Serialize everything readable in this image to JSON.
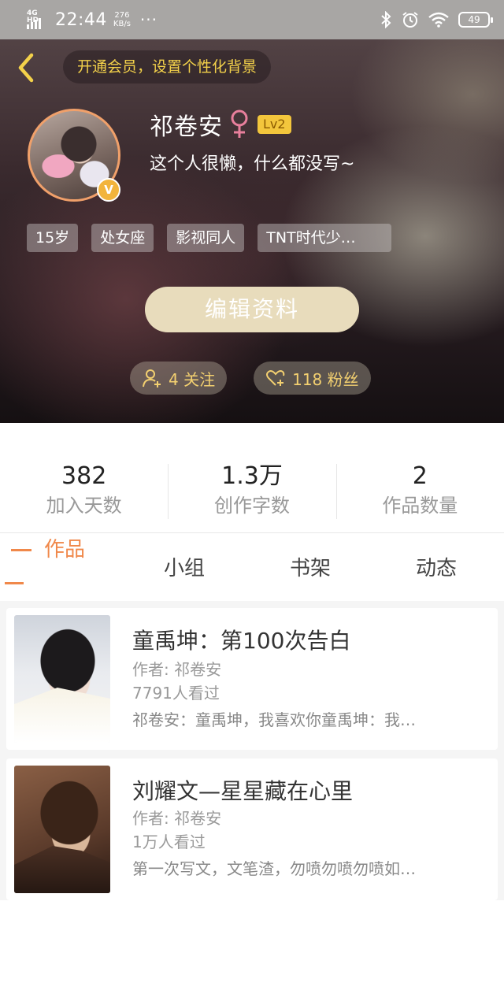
{
  "status_bar": {
    "network": "4G HD",
    "time": "22:44",
    "speed_value": "276",
    "speed_unit": "KB/s",
    "more": "···",
    "battery": "49"
  },
  "header": {
    "vip_banner": "开通会员，设置个性化背景"
  },
  "profile": {
    "name": "祁卷安",
    "level": "Lv2",
    "verified_badge": "V",
    "bio": "这个人很懒，什么都没写~",
    "tags": [
      "15岁",
      "处女座",
      "影视同人",
      "TNT时代少…"
    ],
    "edit_button": "编辑资料",
    "following": "4 关注",
    "followers": "118 粉丝"
  },
  "stats": [
    {
      "value": "382",
      "label": "加入天数"
    },
    {
      "value": "1.3万",
      "label": "创作字数"
    },
    {
      "value": "2",
      "label": "作品数量"
    }
  ],
  "tabs": [
    "作品",
    "小组",
    "书架",
    "动态"
  ],
  "works": [
    {
      "title": "童禹坤：第100次告白",
      "author": "作者: 祁卷安",
      "views": "7791人看过",
      "desc": "祁卷安：童禹坤，我喜欢你童禹坤：我…"
    },
    {
      "title": "刘耀文—星星藏在心里",
      "author": "作者: 祁卷安",
      "views": "1万人看过",
      "desc": "第一次写文，文笔渣，勿喷勿喷勿喷如…"
    }
  ],
  "colors": {
    "accent": "#f0884a",
    "vip_gold": "#f3d14a",
    "edit_button_bg": "#e8dcbc",
    "gender_pink": "#e87f9c"
  },
  "icons": [
    "back-arrow-icon",
    "bluetooth-icon",
    "alarm-icon",
    "wifi-icon",
    "battery-icon",
    "female-icon",
    "add-follow-icon",
    "heart-plus-icon"
  ]
}
